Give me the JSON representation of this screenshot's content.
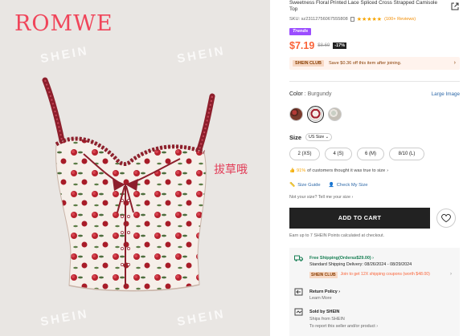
{
  "brand": {
    "logo_text": "ROMWE",
    "watermark": "SHEIN",
    "overlay_text": "拔草哦"
  },
  "product": {
    "title": "Sweetness Floral Printed Lace Spliced Cross Strapped Camisole Top",
    "sku": "SKU: sz23112756067555808",
    "rating_stars": "★★★★★",
    "reviews": "(100+ Reviews)",
    "trend_badge": "Trends",
    "price": "$7.19",
    "original_price": "$8.69",
    "discount": "-17%"
  },
  "club_promo": {
    "tag": "SHEIN CLUB",
    "text": "Save $0.36 off this item after joining."
  },
  "color": {
    "label": "Color",
    "separator": " : ",
    "value": "Burgundy",
    "large_image_link": "Large Image",
    "swatches": [
      {
        "name": "brown-floral",
        "selected": false
      },
      {
        "name": "burgundy",
        "selected": true
      },
      {
        "name": "light-floral",
        "selected": false
      }
    ]
  },
  "size": {
    "label": "Size",
    "system": "US Size",
    "options": [
      "2 (XS)",
      "4 (S)",
      "6 (M)",
      "8/10 (L)"
    ],
    "fit_percent": "91%",
    "fit_text": " of customers thought it was true to size",
    "size_guide": "Size Guide",
    "check_my_size": "Check My Size",
    "not_your_size": "Not your size? Tell me your size"
  },
  "actions": {
    "add_to_cart": "ADD TO CART"
  },
  "points": "Earn up to 7 SHEIN Points calculated at checkout.",
  "shipping": {
    "free_title": "Free Shipping(Orders≥$29.00)",
    "standard": "Standard Shipping Delivery: 08/26/2024 - 08/29/2024",
    "club_tag": "SHEIN CLUB",
    "club_text": "Join to get 12X shipping coupons (worth $48.00)",
    "return_title": "Return Policy",
    "learn_more": "Learn More",
    "sold_by": "Sold by SHEIN",
    "ships_from": "Ships from SHEIN",
    "report": "To report this seller and/or product"
  },
  "colors": {
    "price": "#fa6338",
    "trend": "#9b4dff",
    "link": "#2d68a8",
    "green": "#198055",
    "brand": "#f0455a"
  }
}
